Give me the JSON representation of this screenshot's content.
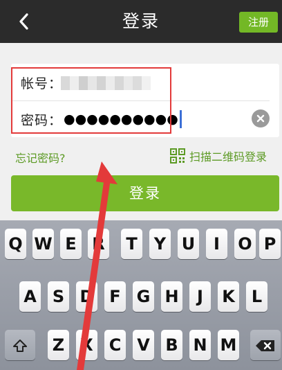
{
  "header": {
    "title": "登录",
    "register_label": "注册"
  },
  "form": {
    "account_label": "帐号：",
    "password_label": "密码：",
    "password_mask": "●●●●●●●●●●"
  },
  "links": {
    "forgot_password": "忘记密码?",
    "qr_login": "扫描二维码登录"
  },
  "login_button": "登录",
  "keyboard": {
    "row1": [
      "Q",
      "W",
      "E",
      "R",
      "T",
      "Y",
      "U",
      "I",
      "O",
      "P"
    ],
    "row2": [
      "A",
      "S",
      "D",
      "F",
      "G",
      "H",
      "J",
      "K",
      "L"
    ],
    "row3": [
      "Z",
      "X",
      "C",
      "V",
      "B",
      "N",
      "M"
    ],
    "shift_icon": "shift-icon",
    "delete_icon": "backspace-icon"
  },
  "colors": {
    "nav_bg": "#2b2b2b",
    "accent_green": "#79b82a",
    "link_green": "#5c9a24",
    "annotation_red": "#e33a3a"
  }
}
